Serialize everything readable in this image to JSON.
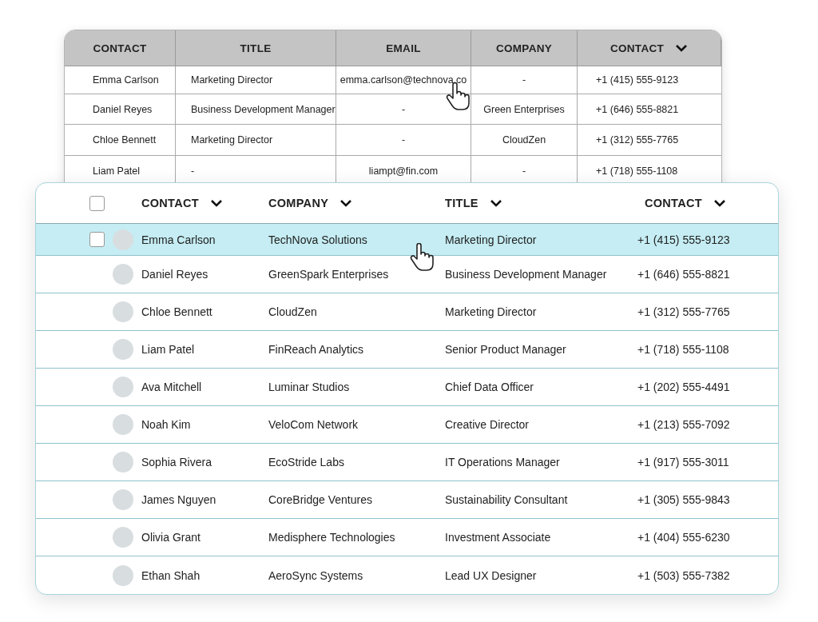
{
  "back_table": {
    "columns": [
      {
        "label": "CONTACT",
        "sortable": false
      },
      {
        "label": "TITLE",
        "sortable": false
      },
      {
        "label": "EMAIL",
        "sortable": false
      },
      {
        "label": "COMPANY",
        "sortable": false
      },
      {
        "label": "CONTACT",
        "sortable": true
      }
    ],
    "rows": [
      {
        "contact": "Emma Carlson",
        "title": "Marketing Director",
        "email": "emma.carlson@technova.co",
        "company": "-",
        "phone": "+1 (415) 555-9123"
      },
      {
        "contact": "Daniel Reyes",
        "title": "Business Development Manager",
        "email": "-",
        "company": "Green Enterprises",
        "phone": "+1 (646) 555-8821"
      },
      {
        "contact": "Chloe Bennett",
        "title": "Marketing Director",
        "email": "-",
        "company": "CloudZen",
        "phone": "+1 (312) 555-7765"
      },
      {
        "contact": "Liam Patel",
        "title": "-",
        "email": "liampt@fin.com",
        "company": "-",
        "phone": "+1 (718) 555-1108"
      }
    ]
  },
  "front_table": {
    "select_all": {
      "checked": false
    },
    "columns": [
      {
        "label": "CONTACT",
        "sortable": true
      },
      {
        "label": "COMPANY",
        "sortable": true
      },
      {
        "label": "TITLE",
        "sortable": true
      },
      {
        "label": "CONTACT",
        "sortable": true
      }
    ],
    "rows": [
      {
        "name": "Emma Carlson",
        "company": "TechNova Solutions",
        "title": "Marketing Director",
        "phone": "+1 (415) 555-9123",
        "selected": true
      },
      {
        "name": "Daniel Reyes",
        "company": "GreenSpark Enterprises",
        "title": "Business Development Manager",
        "phone": "+1 (646) 555-8821",
        "selected": false
      },
      {
        "name": "Chloe Bennett",
        "company": "CloudZen",
        "title": "Marketing Director",
        "phone": "+1 (312) 555-7765",
        "selected": false
      },
      {
        "name": "Liam Patel",
        "company": "FinReach Analytics",
        "title": "Senior Product Manager",
        "phone": "+1 (718) 555-1108",
        "selected": false
      },
      {
        "name": "Ava Mitchell",
        "company": "Luminar Studios",
        "title": "Chief Data Officer",
        "phone": "+1 (202) 555-4491",
        "selected": false
      },
      {
        "name": "Noah Kim",
        "company": "VeloCom Network",
        "title": "Creative Director",
        "phone": "+1 (213) 555-7092",
        "selected": false
      },
      {
        "name": "Sophia Rivera",
        "company": "EcoStride Labs",
        "title": "IT Operations Manager",
        "phone": "+1 (917) 555-3011",
        "selected": false
      },
      {
        "name": "James Nguyen",
        "company": "CoreBridge Ventures",
        "title": "Sustainability Consultant",
        "phone": "+1 (305) 555-9843",
        "selected": false
      },
      {
        "name": "Olivia Grant",
        "company": "Medisphere Technologies",
        "title": "Investment Associate",
        "phone": "+1 (404) 555-6230",
        "selected": false
      },
      {
        "name": "Ethan Shah",
        "company": "AeroSync Systems",
        "title": "Lead UX Designer",
        "phone": "+1 (503) 555-7382",
        "selected": false
      }
    ]
  }
}
